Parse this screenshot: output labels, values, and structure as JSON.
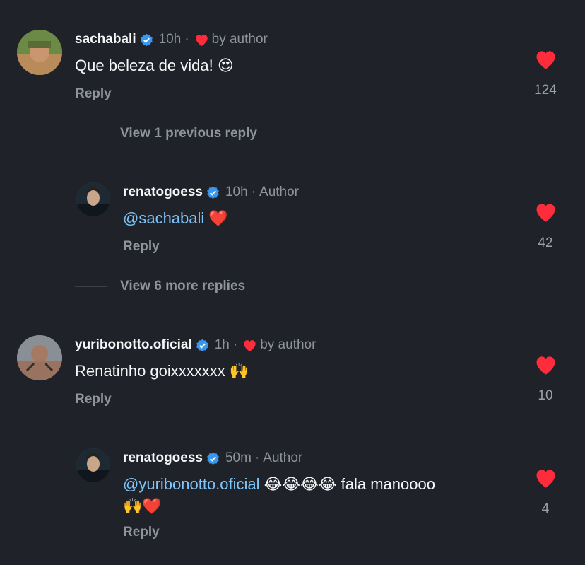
{
  "colors": {
    "background": "#1f2228",
    "heart": "#ff2d3b",
    "mention": "#7fc4f8",
    "verified": "#3897f0",
    "muted": "#8e939c"
  },
  "comments": [
    {
      "username": "sachabali",
      "time": "10h",
      "meta": "by author",
      "text": "Que beleza de vida! ",
      "emoji": "😍",
      "reply_label": "Reply",
      "likes": "124"
    },
    {
      "username": "renatogoess",
      "time": "10h",
      "meta": "Author",
      "mention": "@sachabali",
      "emoji": "❤️",
      "reply_label": "Reply",
      "likes": "42"
    },
    {
      "username": "yuribonotto.oficial",
      "time": "1h",
      "meta": "by author",
      "text": "Renatinho goixxxxxxx ",
      "emoji": "🙌",
      "reply_label": "Reply",
      "likes": "10"
    },
    {
      "username": "renatogoess",
      "time": "50m",
      "meta": "Author",
      "mention": "@yuribonotto.oficial",
      "emoji": "😂😂😂😂",
      "text": " fala manoooo",
      "emoji2": "🙌❤️",
      "reply_label": "Reply",
      "likes": "4"
    }
  ],
  "view_previous": "View 1 previous reply",
  "view_more": "View 6 more replies",
  "icons": [
    "verified-badge-icon",
    "heart-icon",
    "avatar"
  ]
}
